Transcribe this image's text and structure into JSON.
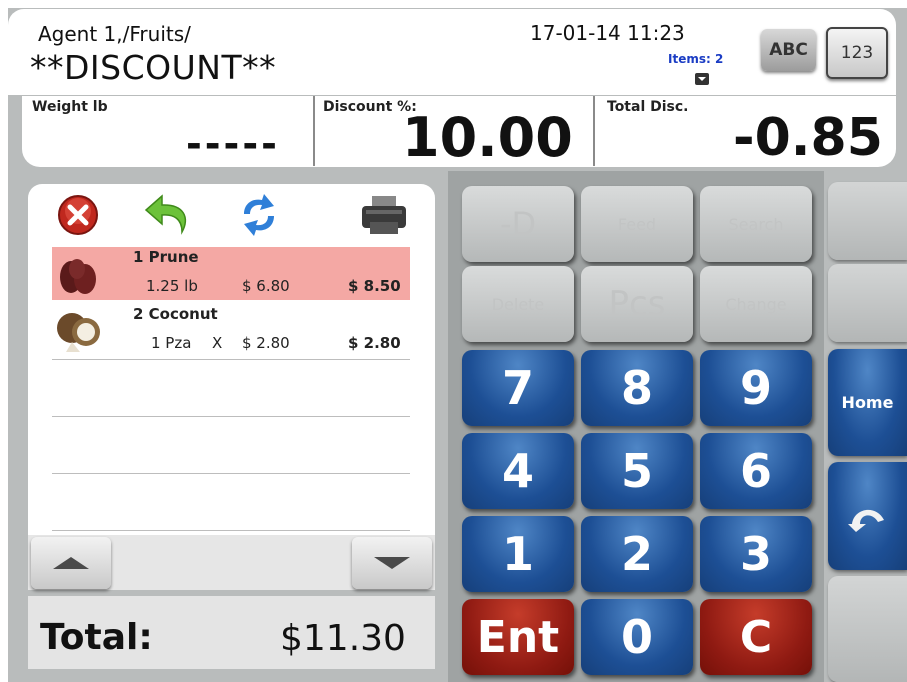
{
  "header": {
    "agent": "Agent 1,/Fruits/",
    "mode_title": "**DISCOUNT**",
    "datetime": "17-01-14 11:23",
    "items_count": "Items: 2",
    "abc_button": "ABC",
    "num_button": "123"
  },
  "info": {
    "weight_label": "Weight lb",
    "weight_value": "-----",
    "discount_label": "Discount %:",
    "discount_value": "10.00",
    "total_disc_label": "Total Disc.",
    "total_disc_value": "-0.85"
  },
  "toolbar": {
    "cancel_icon": "cancel-icon",
    "undo_icon": "undo-arrow-icon",
    "refresh_icon": "refresh-icon",
    "print_icon": "printer-icon"
  },
  "items": [
    {
      "name": "1 Prune",
      "qty": "1.25 lb",
      "x": "",
      "price": "$ 6.80",
      "amount": "$ 8.50",
      "highlighted": true,
      "icon": "prune-image"
    },
    {
      "name": "2 Coconut",
      "qty": "1 Pza",
      "x": "X",
      "price": "$ 2.80",
      "amount": "$ 2.80",
      "highlighted": false,
      "icon": "coconut-image"
    }
  ],
  "total": {
    "label": "Total:",
    "value": "$11.30"
  },
  "keypad": {
    "row1": [
      "-D",
      "Feed",
      "Search"
    ],
    "row2": [
      "Delete",
      "Pcs",
      "Change"
    ],
    "digits": [
      "7",
      "8",
      "9",
      "4",
      "5",
      "6",
      "1",
      "2",
      "3"
    ],
    "enter": "Ent",
    "zero": "0",
    "clear": "C"
  },
  "side": {
    "home": "Home",
    "back_icon": "back-arrow-icon"
  },
  "colors": {
    "highlight": "#f4a8a4",
    "key_blue": "#1d4f95",
    "key_red": "#8f1a12",
    "items_text": "#1a3cc4"
  }
}
